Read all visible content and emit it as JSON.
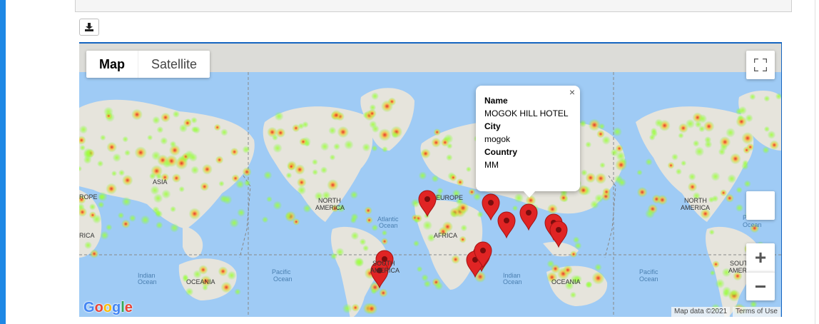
{
  "toolbar": {
    "download_icon": "download-icon"
  },
  "map": {
    "type_control": {
      "map_label": "Map",
      "satellite_label": "Satellite",
      "selected": "Map"
    },
    "continent_labels": [
      "ROPE",
      "ASIA",
      "RICA",
      "OCEANIA",
      "NORTH",
      "AMERICA",
      "Atlantic",
      "Ocean",
      "EUROPE",
      "AFRICA",
      "SOUTH",
      "AMERICA",
      "Pacific",
      "Ocean",
      "Indian",
      "Ocean",
      "Indian",
      "Ocean",
      "OCEANIA",
      "NORTH",
      "AMERICA",
      "Pacific",
      "Ocean",
      "SOUTH",
      "AMERI",
      "Pacific",
      "Ocean"
    ],
    "info_window": {
      "name_label": "Name",
      "name_value": "MOGOK HILL HOTEL",
      "city_label": "City",
      "city_value": "mogok",
      "country_label": "Country",
      "country_value": "MM",
      "close_symbol": "×"
    },
    "markers_count": 11,
    "attribution": {
      "map_data": "Map data ©2021",
      "terms": "Terms of Use"
    },
    "logo": "Google",
    "controls": {
      "zoom_in": "+",
      "zoom_out": "−"
    },
    "colors": {
      "water": "#9fcbf5",
      "land": "#e6e4dc",
      "marker": "#e02424",
      "heat_low": "#7dff3a",
      "heat_high": "#e8281e"
    }
  }
}
